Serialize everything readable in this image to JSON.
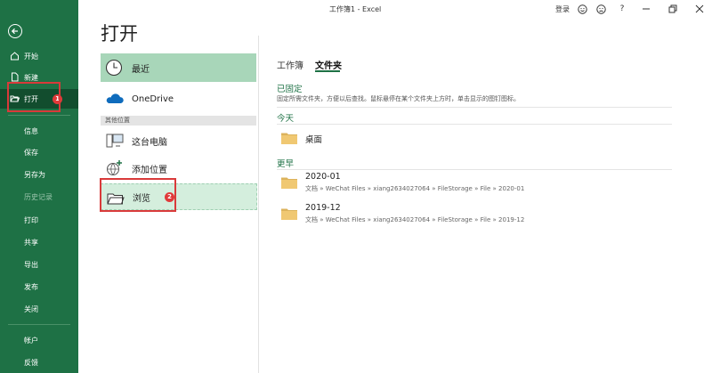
{
  "window": {
    "title": "工作簿1 - Excel",
    "login_label": "登录"
  },
  "titlebar_buttons": [
    "smiley-icon",
    "frown-icon",
    "help-icon",
    "minimize-icon",
    "restore-icon",
    "close-icon"
  ],
  "help_label": "?",
  "nav": {
    "items": [
      {
        "label": "开始",
        "icon": "home-icon"
      },
      {
        "label": "新建",
        "icon": "new-doc-icon"
      },
      {
        "label": "打开",
        "icon": "folder-open-icon",
        "badge": "1",
        "active": true
      },
      {
        "label": "信息"
      },
      {
        "label": "保存"
      },
      {
        "label": "另存为"
      },
      {
        "label": "历史记录",
        "disabled": true
      },
      {
        "label": "打印"
      },
      {
        "label": "共享"
      },
      {
        "label": "导出"
      },
      {
        "label": "发布"
      },
      {
        "label": "关闭"
      },
      {
        "label": "帐户"
      },
      {
        "label": "反馈"
      }
    ]
  },
  "page": {
    "title": "打开"
  },
  "locations": {
    "recent": "最近",
    "onedrive": "OneDrive",
    "section": "其他位置",
    "this_pc": "这台电脑",
    "add_place": "添加位置",
    "browse": "浏览",
    "browse_badge": "2"
  },
  "tabs": {
    "workbook": "工作簿",
    "folder": "文件夹"
  },
  "groups": {
    "pinned": {
      "title": "已固定",
      "desc": "固定所需文件夹，方便以后查找。鼠标悬停在某个文件夹上方时，单击显示的图钉图标。"
    },
    "today": {
      "title": "今天",
      "items": [
        {
          "name": "桌面"
        }
      ]
    },
    "older": {
      "title": "更早",
      "items": [
        {
          "name": "2020-01",
          "path": "文档 » WeChat Files » xiang2634027064 » FileStorage » File » 2020-01"
        },
        {
          "name": "2019-12",
          "path": "文档 » WeChat Files » xiang2634027064 » FileStorage » File » 2019-12"
        }
      ]
    }
  },
  "colors": {
    "accent": "#1e7145",
    "selected": "#a8d6b9",
    "badge": "#e03a3a"
  }
}
